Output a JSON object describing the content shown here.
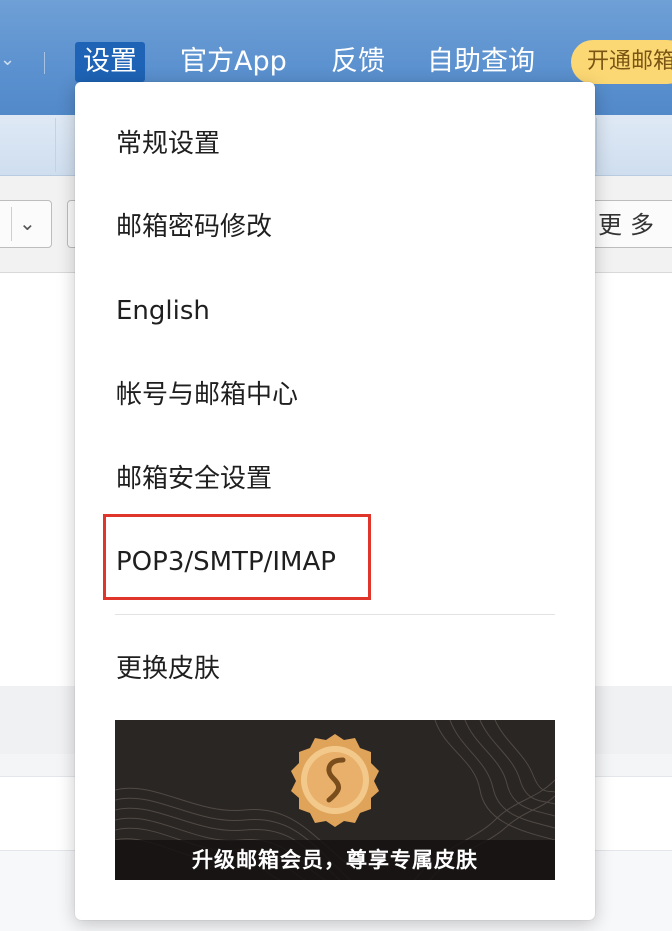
{
  "topnav": {
    "settings_label": "设置",
    "app_label": "官方App",
    "feedback_label": "反馈",
    "selfhelp_label": "自助查询",
    "upgrade_label": "开通邮箱"
  },
  "toolbar": {
    "more_label": "更多"
  },
  "settings_menu": {
    "items": [
      "常规设置",
      "邮箱密码修改",
      "English",
      "帐号与邮箱中心",
      "邮箱安全设置",
      "POP3/SMTP/IMAP",
      "更换皮肤"
    ],
    "promo_caption": "升级邮箱会员，尊享专属皮肤"
  },
  "colors": {
    "topbar": "#5b91cf",
    "active_tab": "#1e63b5",
    "upgrade_pill": "#fcd874",
    "highlight_box": "#e0352b",
    "promo_bg": "#2a2624",
    "badge_gold": "#e0a35a"
  },
  "icons": {
    "nav_left": "chevron-down-icon",
    "toolbar_dropdown": "chevron-down-icon",
    "promo_badge": "member-badge-icon"
  }
}
